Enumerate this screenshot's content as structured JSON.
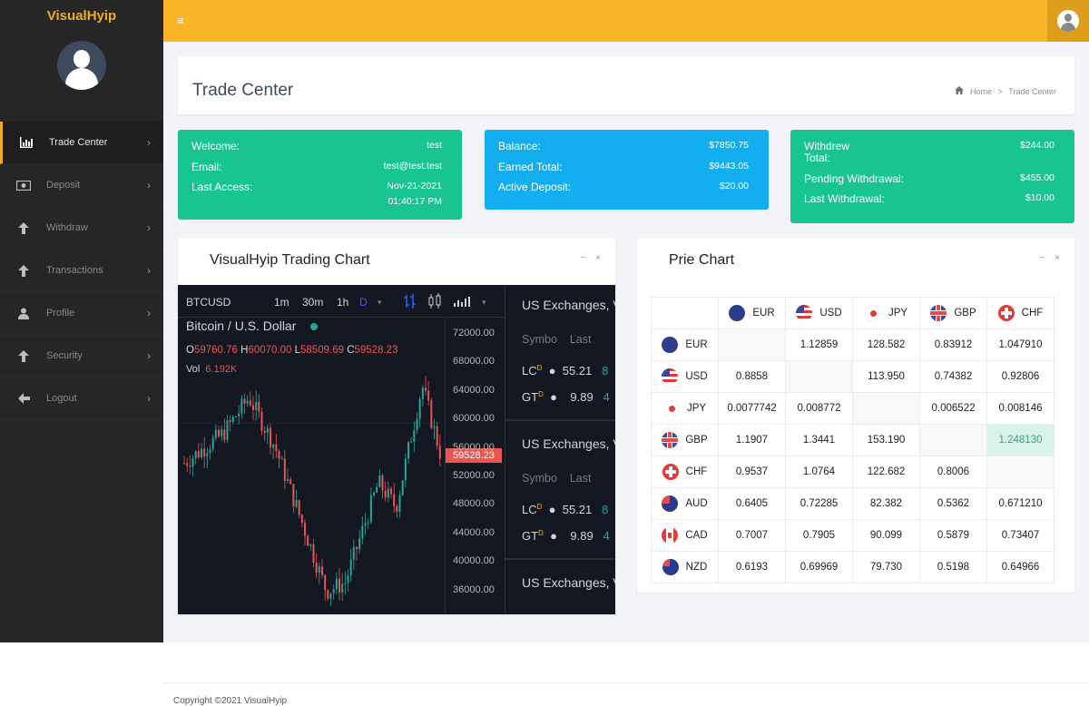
{
  "brand": "VisualHyip",
  "sidebar": {
    "items": [
      {
        "label": "Trade Center",
        "icon": "bar-chart-icon"
      },
      {
        "label": "Deposit",
        "icon": "money-icon"
      },
      {
        "label": "Withdraw",
        "icon": "arrow-up-icon"
      },
      {
        "label": "Transactions",
        "icon": "arrow-up-icon"
      },
      {
        "label": "Profile",
        "icon": "user-icon"
      },
      {
        "label": "Security",
        "icon": "arrow-up-icon"
      },
      {
        "label": "Logout",
        "icon": "arrow-left-icon"
      }
    ],
    "chevron": "›"
  },
  "topbar": {
    "menu_glyph": "≡"
  },
  "header": {
    "title": "Trade Center",
    "breadcrumb": {
      "home": "Home",
      "sep": ">",
      "current": "Trade Center"
    }
  },
  "stats": {
    "welcome": {
      "label": "Welcome:",
      "value": "test"
    },
    "email": {
      "label": "Email:",
      "value": "test@test.test"
    },
    "last_access": {
      "label": "Last Access:",
      "date": "Nov-21-2021",
      "time": "01:40:17 PM"
    },
    "balance": {
      "label": "Balance:",
      "value": "$7850.75"
    },
    "earned": {
      "label": "Earned Total:",
      "value": "$9443.05"
    },
    "active": {
      "label": "Active Deposit:",
      "value": "$20.00"
    },
    "withdrew": {
      "label_1": "Withdrew",
      "label_2": "Total:",
      "value": "$244.00"
    },
    "pending": {
      "label": "Pending Withdrawal:",
      "value": "$455.00"
    },
    "last_withdrawal": {
      "label": "Last Withdrawal:",
      "value": "$10.00"
    }
  },
  "trading": {
    "title": "VisualHyip Trading Chart",
    "controls": {
      "minimize": "−",
      "close": "×"
    },
    "symbol": "BTCUSD",
    "intervals": [
      "1m",
      "30m",
      "1h",
      "D"
    ],
    "pair_name": "Bitcoin / U.S. Dollar",
    "ohlc": {
      "o_label": "O",
      "o": "59760.76",
      "h_label": "H",
      "h": "60070.00",
      "l_label": "L",
      "l": "58509.69",
      "c_label": "C",
      "c": "59528.23"
    },
    "volume": {
      "label": "Vol",
      "value": "6.192K"
    },
    "price_ticks": [
      "72000.00",
      "68000.00",
      "64000.00",
      "60000.00",
      "56000.00",
      "52000.00",
      "48000.00",
      "44000.00",
      "40000.00",
      "36000.00"
    ],
    "last_price": "59528.23",
    "exchanges": {
      "title": "US Exchanges, V",
      "col_symbol": "Symbo",
      "col_last": "Last",
      "rows": [
        {
          "sym": "LC",
          "badge": "D",
          "last": "55.21",
          "chg": "8"
        },
        {
          "sym": "GT",
          "badge": "D",
          "last": "9.89",
          "chg": "4"
        }
      ]
    }
  },
  "rates": {
    "title": "Prie Chart",
    "controls": {
      "minimize": "−",
      "close": "×"
    },
    "columns": [
      "EUR",
      "USD",
      "JPY",
      "GBP",
      "CHF"
    ],
    "rows": [
      {
        "cur": "EUR",
        "vals": [
          "",
          "1.12859",
          "128.582",
          "0.83912",
          "1.047910"
        ]
      },
      {
        "cur": "USD",
        "vals": [
          "0.8858",
          "",
          "113.950",
          "0.74382",
          "0.92806"
        ]
      },
      {
        "cur": "JPY",
        "vals": [
          "0.0077742",
          "0.008772",
          "",
          "0.006522",
          "0.008146"
        ]
      },
      {
        "cur": "GBP",
        "vals": [
          "1.1907",
          "1.3441",
          "153.190",
          "",
          "1.248130"
        ]
      },
      {
        "cur": "CHF",
        "vals": [
          "0.9537",
          "1.0764",
          "122.682",
          "0.8006",
          ""
        ]
      },
      {
        "cur": "AUD",
        "vals": [
          "0.6405",
          "0.72285",
          "82.382",
          "0.5362",
          "0.671210"
        ]
      },
      {
        "cur": "CAD",
        "vals": [
          "0.7007",
          "0.7905",
          "90.099",
          "0.5879",
          "0.73407"
        ]
      },
      {
        "cur": "NZD",
        "vals": [
          "0.6193",
          "0.69969",
          "79.730",
          "0.5198",
          "0.64966"
        ]
      }
    ],
    "highlight": {
      "row": 3,
      "col": 4
    }
  },
  "footer": "Copyright ©2021 VisualHyip",
  "colors": {
    "accent": "#f7b527",
    "green": "#18c490",
    "blue": "#13aef0",
    "sidebar": "#262626",
    "chart_bg": "#131722"
  }
}
